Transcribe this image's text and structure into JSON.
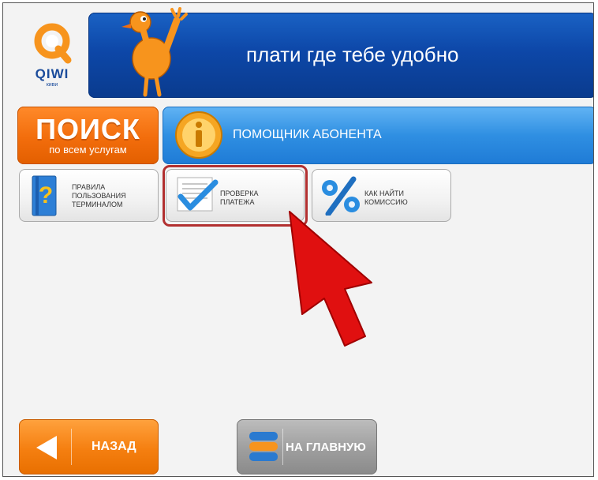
{
  "logo": {
    "text": "QIWI",
    "subtext": "киви"
  },
  "banner": {
    "slogan": "плати где тебе удобно"
  },
  "search": {
    "title": "ПОИСК",
    "subtitle": "по всем услугам"
  },
  "assistant": {
    "label": "ПОМОЩНИК АБОНЕНТА"
  },
  "tiles": [
    {
      "label": "ПРАВИЛА\nПОЛЬЗОВАНИЯ\nТЕРМИНАЛОМ",
      "icon": "question-book-icon"
    },
    {
      "label": "ПРОВЕРКА\nПЛАТЕЖА",
      "icon": "checkmark-document-icon"
    },
    {
      "label": "КАК НАЙТИ\nКОМИССИЮ",
      "icon": "percent-icon"
    }
  ],
  "nav": {
    "back_label": "НАЗАД",
    "home_label": "НА ГЛАВНУЮ"
  },
  "colors": {
    "brand_orange": "#f26d0c",
    "brand_blue": "#0d47a8",
    "highlight_red": "#b23030",
    "arrow_red": "#e01010"
  }
}
